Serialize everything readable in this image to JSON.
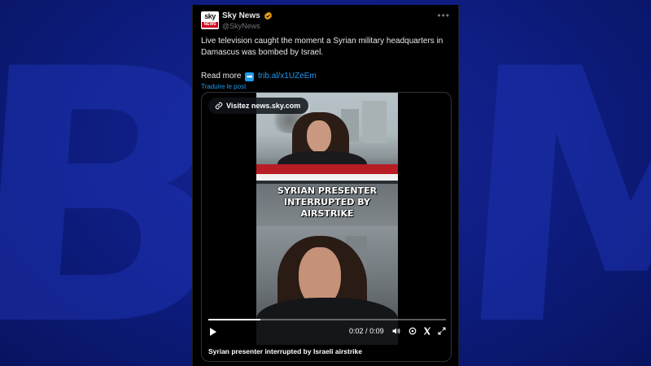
{
  "background": {
    "watermark_text": "BFM"
  },
  "tweet": {
    "display_name": "Sky News",
    "handle": "@SkyNews",
    "avatar_text": "sky",
    "avatar_subtext": "NEWS",
    "body": "Live television caught the moment a Syrian military headquarters in Damascus was bombed by Israel.",
    "read_more_label": "Read more",
    "arrow_emoji": "➡",
    "link_text": "trib.al/x1UZeEm",
    "translate_label": "Traduire le post"
  },
  "media": {
    "visit_label": "Visitez news.sky.com",
    "overlay_title_lines": [
      "SYRIAN PRESENTER",
      "INTERRUPTED BY",
      "AIRSTRIKE"
    ],
    "current_time": "0:02",
    "duration": "0:09",
    "time_separator": "/",
    "progress_fraction": 0.22,
    "caption": "Syrian presenter interrupted by Israeli airstrike"
  },
  "colors": {
    "link": "#1d9bf0",
    "verified": "#e8a317",
    "background": "#0b1a73"
  }
}
